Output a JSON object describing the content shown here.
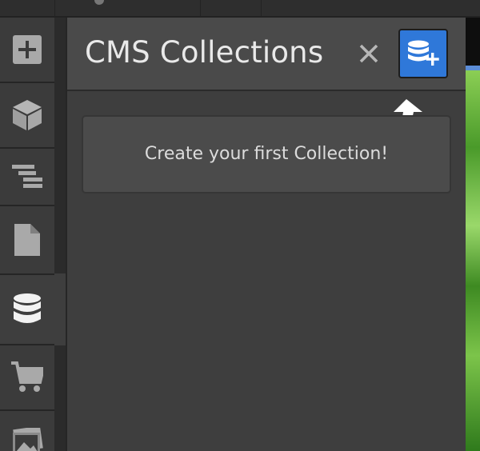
{
  "panel": {
    "title": "CMS Collections",
    "empty_message": "Create your first Collection!"
  },
  "toolbar": {
    "items": [
      {
        "icon": "add-panel-icon",
        "active": false
      },
      {
        "icon": "components-cube-icon",
        "active": false
      },
      {
        "icon": "navigator-layers-icon",
        "active": false
      },
      {
        "icon": "pages-icon",
        "active": false
      },
      {
        "icon": "cms-database-icon",
        "active": true
      },
      {
        "icon": "ecommerce-cart-icon",
        "active": false
      },
      {
        "icon": "assets-images-icon",
        "active": false
      }
    ]
  },
  "colors": {
    "accent": "#2f78d9",
    "panel_bg": "#3e3e3e",
    "header_bg": "#4a4a4a",
    "toolbar_bg": "#3b3b3b",
    "text": "#e9e9e9"
  }
}
